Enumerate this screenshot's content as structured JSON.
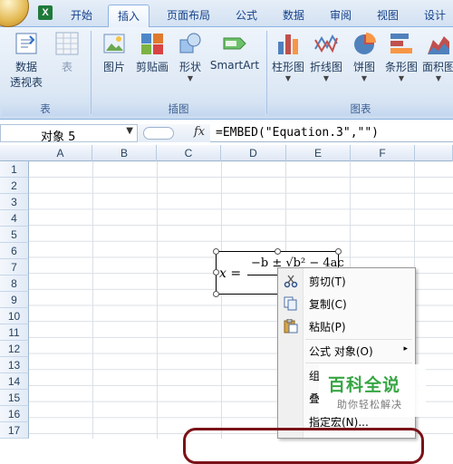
{
  "tabs": [
    {
      "label": "开始",
      "active": false
    },
    {
      "label": "插入",
      "active": true
    },
    {
      "label": "页面布局",
      "active": false
    },
    {
      "label": "公式",
      "active": false
    },
    {
      "label": "数据",
      "active": false
    },
    {
      "label": "审阅",
      "active": false
    },
    {
      "label": "视图",
      "active": false
    },
    {
      "label": "设计",
      "active": false
    }
  ],
  "ribbon": {
    "groups": {
      "table": "表",
      "illustrations": "插图",
      "charts": "图表"
    },
    "buttons": {
      "pivot_line1": "数据",
      "pivot_line2": "透视表",
      "table": "表",
      "picture": "图片",
      "clipart": "剪贴画",
      "shapes": "形状",
      "smartart": "SmartArt",
      "column": "柱形图",
      "line": "折线图",
      "pie": "饼图",
      "bar": "条形图",
      "area": "面积图"
    }
  },
  "formula_bar": {
    "name_box": "对象 5",
    "fx": "fx",
    "formula": "=EMBED(\"Equation.3\",\"\")"
  },
  "columns": [
    "A",
    "B",
    "C",
    "D",
    "E",
    "F"
  ],
  "rows": [
    "1",
    "2",
    "3",
    "4",
    "5",
    "6",
    "7",
    "8",
    "9",
    "10",
    "11",
    "12",
    "13",
    "14",
    "15",
    "16",
    "17"
  ],
  "equation": {
    "lhs": "x =",
    "numerator": "−b ± √b² − 4ac"
  },
  "context_menu": {
    "items": [
      {
        "label": "剪切(T)",
        "icon": "scissors-icon"
      },
      {
        "label": "复制(C)",
        "icon": "copy-icon"
      },
      {
        "label": "粘贴(P)",
        "icon": "paste-icon"
      },
      {
        "label": "公式 对象(O)",
        "icon": "",
        "submenu": "▸"
      },
      {
        "label": "组",
        "icon": ""
      },
      {
        "label": "叠",
        "icon": ""
      },
      {
        "label": "指定宏(N)...",
        "icon": ""
      }
    ]
  },
  "watermark": {
    "title": "百科全说",
    "subtitle": "助你轻松解决"
  },
  "colors": {
    "accent": "#15428b",
    "highlight": "#7a1218",
    "watermark_green": "#37a644"
  }
}
